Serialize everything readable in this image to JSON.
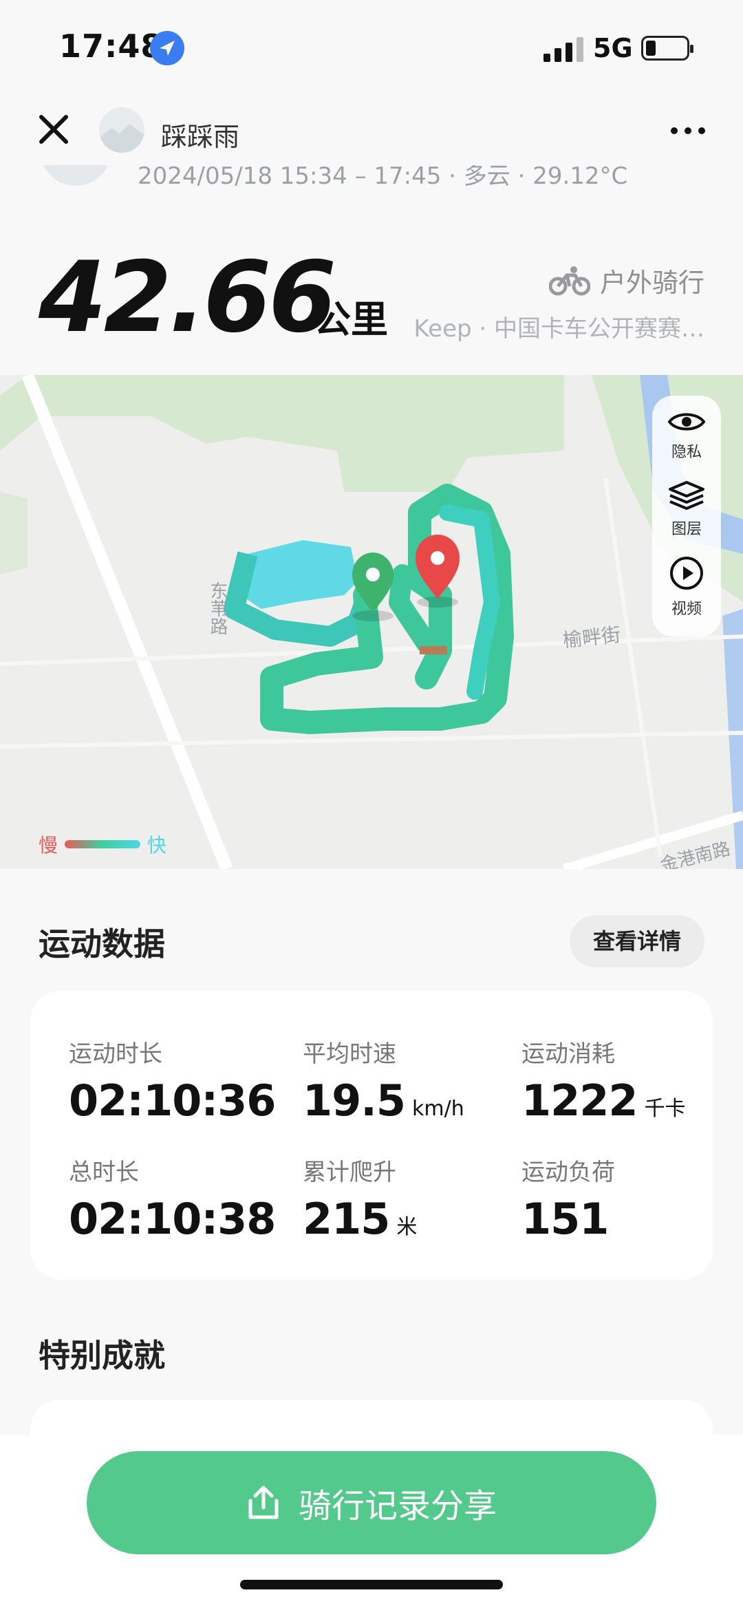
{
  "status_bar": {
    "time": "17:48",
    "network": "5G",
    "battery_level": 0.2,
    "icons": [
      "location-arrow-icon",
      "signal-icon",
      "battery-icon"
    ]
  },
  "nav": {
    "title": "踩踩雨",
    "icons": [
      "close-icon",
      "more-icon"
    ]
  },
  "activity": {
    "meta": "2024/05/18 15:34 – 17:45 · 多云 · 29.12°C",
    "distance": "42.66",
    "distance_unit": "公里",
    "sport_type": "户外骑行",
    "source": "Keep · 中国卡车公开赛赛…"
  },
  "map": {
    "tools": [
      {
        "label": "隐私",
        "icon": "eye-icon"
      },
      {
        "label": "图层",
        "icon": "layers-icon"
      },
      {
        "label": "视频",
        "icon": "play-icon"
      }
    ],
    "street_labels": [
      "东苇路",
      "榆畔街",
      "金港南路"
    ],
    "legend": {
      "slow": "慢",
      "fast": "快"
    },
    "colors": {
      "route": "#3ec79a",
      "route_fast": "#4fd6e3",
      "start_pin": "#3db36e",
      "end_pin": "#e84848",
      "water": "#a9c8f0",
      "green": "#d4e8cf"
    }
  },
  "sport_data": {
    "title": "运动数据",
    "detail_button": "查看详情",
    "stats": [
      {
        "label": "运动时长",
        "value": "02:10:36",
        "unit": ""
      },
      {
        "label": "平均时速",
        "value": "19.5",
        "unit": "km/h"
      },
      {
        "label": "运动消耗",
        "value": "1222",
        "unit": "千卡"
      },
      {
        "label": "总时长",
        "value": "02:10:38",
        "unit": ""
      },
      {
        "label": "累计爬升",
        "value": "215",
        "unit": "米"
      },
      {
        "label": "运动负荷",
        "value": "151",
        "unit": ""
      }
    ]
  },
  "achievements": {
    "title": "特别成就"
  },
  "share": {
    "label": "骑行记录分享",
    "icon": "share-icon",
    "color": "#54c98c"
  }
}
